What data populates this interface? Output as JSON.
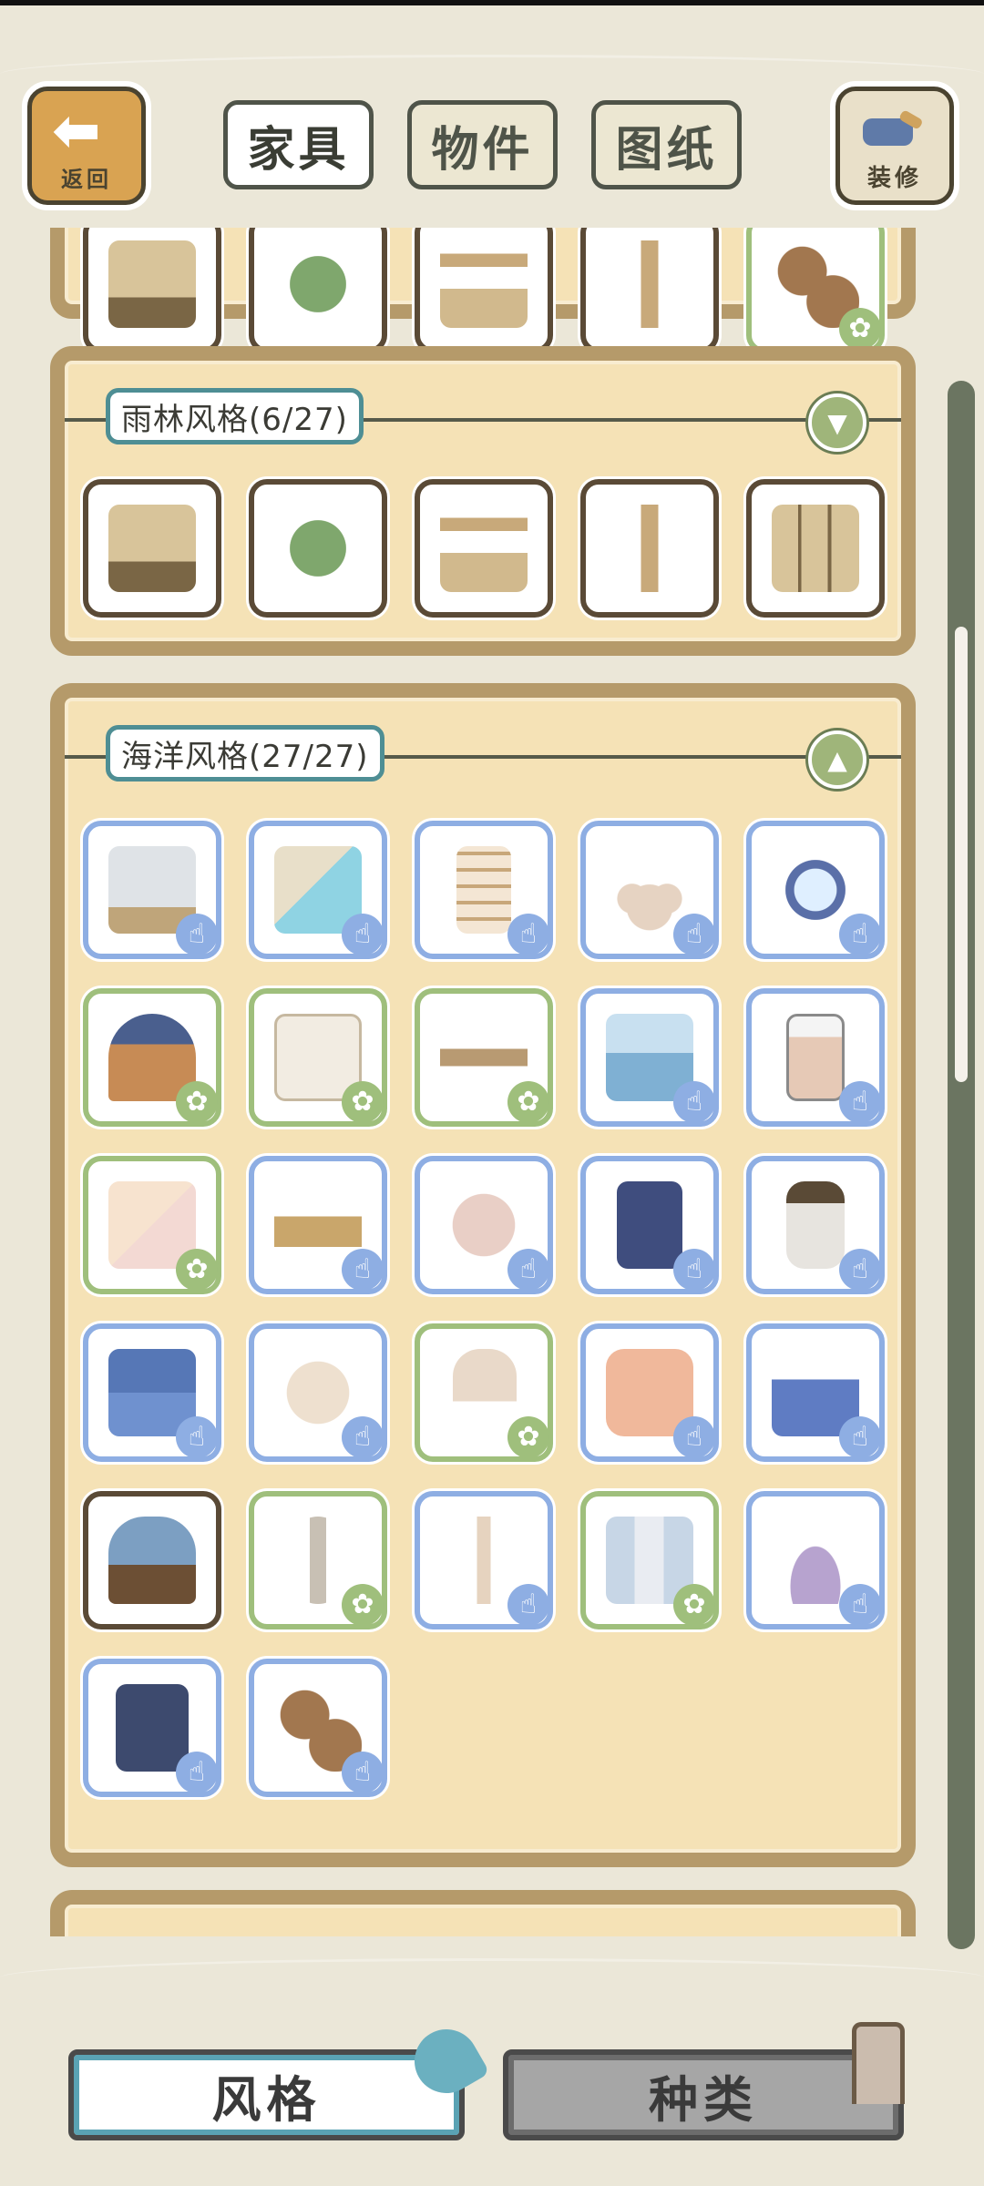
{
  "header": {
    "back_label": "返回",
    "tabs": [
      "家具",
      "物件",
      "图纸"
    ],
    "active_tab": 0,
    "decor_label": "装修"
  },
  "sections": {
    "rainforest": {
      "title": "雨林风格(6/27)",
      "expanded": false
    },
    "ocean": {
      "title": "海洋风格(27/27)",
      "expanded": true
    }
  },
  "bottom_tabs": {
    "style_label": "风格",
    "kind_label": "种类",
    "active": "风格"
  },
  "colors": {
    "page_bg": "#ebe7d8",
    "panel_bg": "#f5e2b6",
    "panel_border": "#b59a6a",
    "section_title_border": "#4e8e94",
    "blue_tile": "#8eaee3",
    "green_tile": "#9fbf7c",
    "toggle": "#9fb57a"
  },
  "legend_icons": {
    "blue": "hand-icon",
    "green": "paw-icon"
  }
}
